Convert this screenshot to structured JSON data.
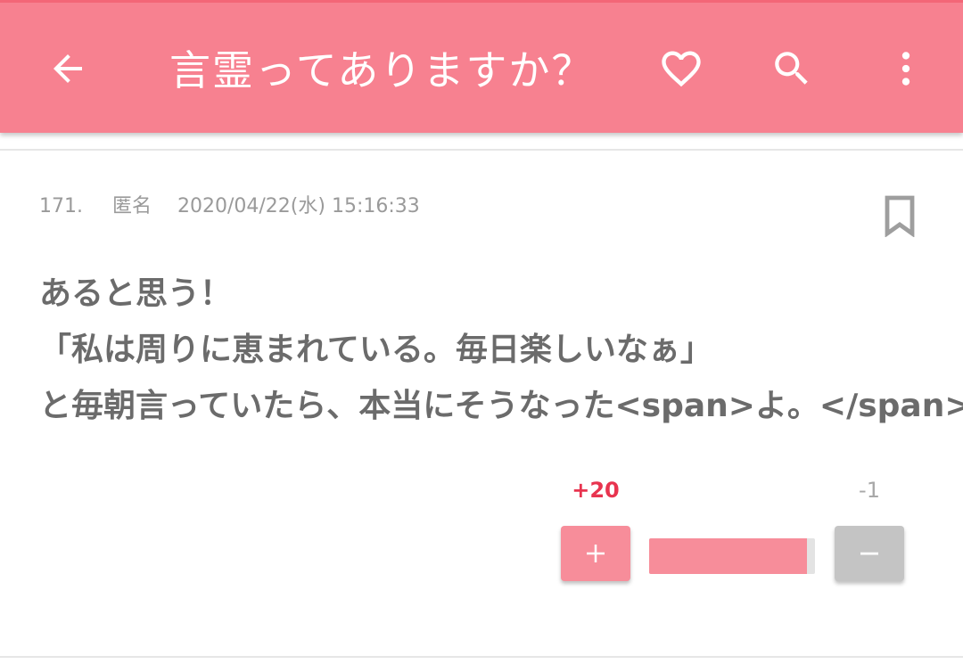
{
  "header": {
    "title": "言霊ってありますか？",
    "back_icon": "arrow-left-icon",
    "favorite_icon": "heart-outline-icon",
    "search_icon": "search-icon",
    "more_icon": "more-vertical-icon",
    "background_color": "#f78190"
  },
  "post": {
    "number": "171.",
    "author": "匿名",
    "datetime": "2020/04/22(水) 15:16:33",
    "bookmark_icon": "bookmark-outline-icon",
    "body_lines": [
      "あると思う！",
      "「私は周りに恵まれている。毎日楽しいなぁ」",
      "と毎朝言っていたら、本当にそうなった<span>よ。</span>"
    ],
    "votes": {
      "plus_label": "+20",
      "minus_label": "-1",
      "plus_symbol": "+",
      "minus_symbol": "−",
      "plus_fraction": 0.9524,
      "plus_color": "#e8344f",
      "bar_color": "#f78d9a"
    }
  }
}
